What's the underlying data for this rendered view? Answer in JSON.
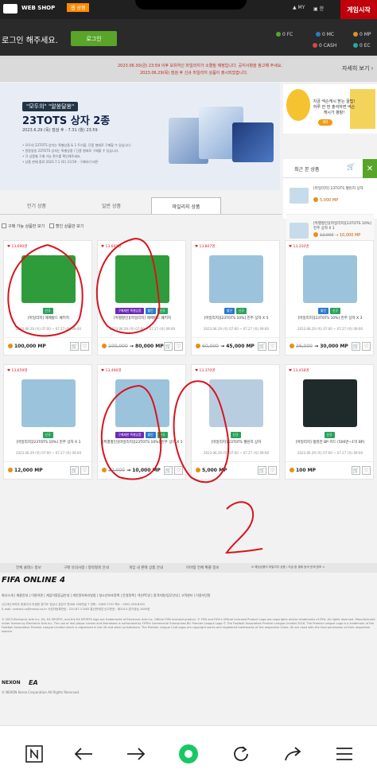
{
  "header": {
    "brand": "WEB SHOP",
    "nav": [
      "웹 상점",
      "경기장",
      "이벤트"
    ],
    "my": "MY",
    "lang": "한",
    "play_button": "게임시작"
  },
  "login": {
    "prompt": "로그인 해주세요.",
    "button": "로그인",
    "currencies": [
      {
        "label": "0 FC",
        "color": "#58a52a"
      },
      {
        "label": "0 MC",
        "color": "#2a7ac9"
      },
      {
        "label": "0 MP",
        "color": "#e4901e"
      },
      {
        "label": "0 CASH",
        "color": "#d44"
      },
      {
        "label": "0 EC",
        "color": "#2aa"
      }
    ]
  },
  "notice": {
    "line1": "2023.06.30(금) 23:59 이후 보유하신 마일리지가 소멸될 예정입니다. 공지사항을 참고해 주세요.",
    "line2": "2023.06.29(목) 점검 후 신규 마일리지 상품이 출시되었습니다.",
    "detail_button": "자세히 보기"
  },
  "banner": {
    "tag": "\"모두의\" \"알쏭달쏭\"",
    "title": "23TOTS 상자 2종",
    "period": "2023.6.29 (목) 점검 후 - 7.31 (월) 23:59",
    "desc": [
      "• 모두의 23TOTS 상자는 특별상품 & 1 트리플, 단품 형태로 구매할 수 있습니다.",
      "• 알쏭달쏭 23TOTS 상자는 특별상품 / 단품 형태로 구매할 수 있습니다.",
      "• 각 상품별 구매 가능 횟수를 확인해주세요.",
      "• 상품 판매 종료 2023.7.1 (토) 23:59 - 구매하기 버튼"
    ]
  },
  "side_promo": {
    "text": "지금 넥슨캐시 받는 꿀팁! 하루 한 번 출석하면 넥슨캐시가 팡팡!",
    "button": "60"
  },
  "recent": {
    "title": "최근 본 상품",
    "items": [
      {
        "name": "[마일리지] 23TOTS 챌린지 상자",
        "price": "5,000 MP",
        "old_price": ""
      },
      {
        "name": "[특별할인][마일리지][23TOTS 10%] 진주 상자 X 1",
        "price": "10,000 MP",
        "old_price": "12,000"
      }
    ]
  },
  "tabs": [
    "인기 상품",
    "일반 상품",
    "마일리지 상품"
  ],
  "filters": [
    "구매 가능 상품만 보기",
    "할인 상품만 보기"
  ],
  "products": [
    {
      "hearts": "13,690명",
      "badges": [
        {
          "t": "신규",
          "c": "#29a35a"
        }
      ],
      "name": "[마일리지] 에메랄드 패키지",
      "date": "2023.06.29 (목) 07:00 ~ 07.27 (목) 09:00",
      "old_price": "",
      "price": "100,000 MP",
      "thumb": "#2e9c3a"
    },
    {
      "hearts": "13,609명",
      "badges": [
        {
          "t": "구매제한 특별상품",
          "c": "#6a2bb3"
        },
        {
          "t": "할인",
          "c": "#2a7ac9"
        },
        {
          "t": "신규",
          "c": "#29a35a"
        }
      ],
      "name": "[특별할인][마일리지] 에메랄드 패키지",
      "date": "2023.06.29 (목) 07:00 ~ 07.27 (목) 09:00",
      "old_price": "100,000",
      "price": "80,000 MP",
      "thumb": "#2e9c3a"
    },
    {
      "hearts": "13,807명",
      "badges": [
        {
          "t": "할인",
          "c": "#2a7ac9"
        },
        {
          "t": "신규",
          "c": "#29a35a"
        }
      ],
      "name": "[마일리지][23TOTS 10%] 진주 상자 X 5",
      "date": "2023.06.29 (목) 07:00 ~ 07.27 (목) 09:00",
      "old_price": "60,000",
      "price": "45,000 MP",
      "thumb": "#9cc3dc"
    },
    {
      "hearts": "13,350명",
      "badges": [
        {
          "t": "할인",
          "c": "#2a7ac9"
        },
        {
          "t": "신규",
          "c": "#29a35a"
        }
      ],
      "name": "[마일리지][23TOTS 10%] 진주 상자 X 3",
      "date": "2023.06.29 (목) 07:00 ~ 07.27 (목) 09:00",
      "old_price": "36,000",
      "price": "30,000 MP",
      "thumb": "#9cc3dc"
    },
    {
      "hearts": "13,659명",
      "badges": [
        {
          "t": "신규",
          "c": "#29a35a"
        }
      ],
      "name": "[마일리지][23TOTS 10%] 진주 상자 X 1",
      "date": "2023.06.29 (목) 07:00 ~ 07.27 (목) 09:00",
      "old_price": "",
      "price": "12,000 MP",
      "thumb": "#9cc3dc"
    },
    {
      "hearts": "13,496명",
      "badges": [
        {
          "t": "구매제한 특별상품",
          "c": "#6a2bb3"
        },
        {
          "t": "할인",
          "c": "#2a7ac9"
        },
        {
          "t": "신규",
          "c": "#29a35a"
        }
      ],
      "name": "[특별할인][마일리지][23TOTS 10%] 진주 상자 X 1",
      "date": "",
      "old_price": "12,000",
      "price": "10,000 MP",
      "thumb": "#9cc3dc"
    },
    {
      "hearts": "13,370명",
      "badges": [
        {
          "t": "신규",
          "c": "#29a35a"
        }
      ],
      "name": "[마일리지] 23TOTS 챌린지 상자",
      "date": "2023.06.29 (목) 07:00 ~ 07.27 (목) 09:00",
      "old_price": "",
      "price": "5,000 MP",
      "thumb": "#b9cde0"
    },
    {
      "hearts": "13,458명",
      "badges": [
        {
          "t": "신규",
          "c": "#29a35a"
        }
      ],
      "name": "[마일리지] 랭킹전 BP 카드 (500만~1억 BP)",
      "date": "2023.06.29 (목) 07:00 ~ 07.27 (목) 09:00",
      "old_price": "",
      "price": "100 MP",
      "thumb": "#1f2a2a"
    }
  ],
  "footer": {
    "links": [
      "전체 클래스 정보",
      "구매 유의사항 / 청약철회 안내",
      "게임 내 판매 상품 안내",
      "아이템 전체 확률 정보"
    ],
    "right_note": "※ 해당상품이 마일리지 상품 / 지급 중 결제 등의 문제 정보 >",
    "logo": "FIFA ONLINE 4",
    "menu": "회사소개 | 채용안내 | 이용약관 | 게임이용등급안내 | 개인정보처리방침 | 청소년보호정책 | 운영정책 | 넥슨PC방 | 원격지원/업무안내 | 고객센터 | 이용자민원",
    "company": "(주)넥슨코리아 대표이사 이정헌 경기도 성남시 분당구 판교로 256번길 7 전화 : 1588-7701 팩스 : 0502-258-8322",
    "email": "E-mail: contact-us@nexon.co.kr 사업자등록번호 : 220-87-17483 통신판매업 신고번호 : 제2013-경기성남-1659호",
    "legal": "© 2023 Electronic Arts Inc. EA, EA SPORTS, and the EA SPORTS logo are trademarks of Electronic Arts Inc. Official FIFA licensed product. © FIFA and FIFA's Official Licensed Product Logo are copyrights and/or trademarks of FIFA. All rights reserved. Manufactured under license by Electronic Arts Inc. The use of real player names and likenesses is authorised by FIFPro Commercial Enterprises BV. Premier League Logo © The Football Association Premier League Limited 2016. The Premier League Logo is a trademark of the Football Association Premier League Limited which is registered in the UK and other jurisdictions. The Premier League Club logos are copyright works and registered trademarks of the respective Clubs. All are used with the kind permission of their respective owners.",
    "nexon": "NEXON",
    "ea": "EA",
    "copyright": "© NEXON Korea Corporation All Rights Reserved."
  }
}
